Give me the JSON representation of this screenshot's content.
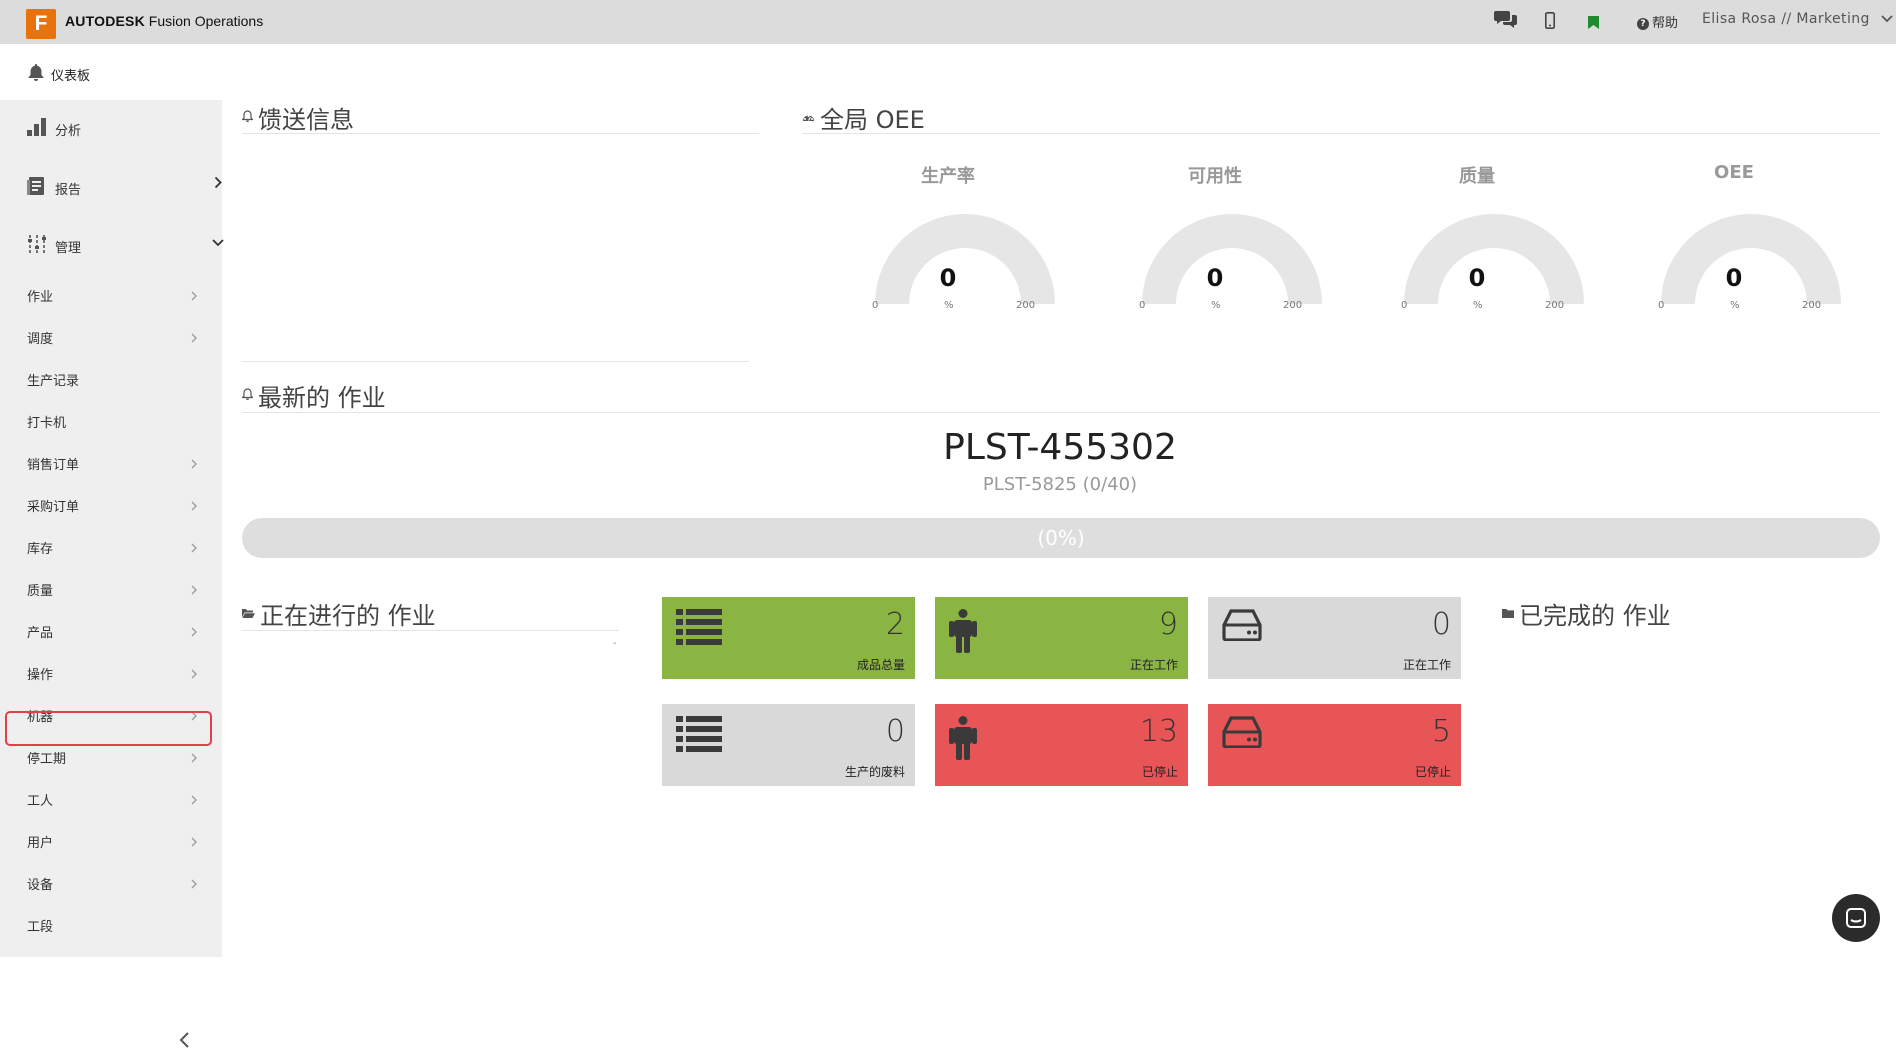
{
  "topbar": {
    "logo_letter": "F",
    "brand_bold": "AUTODESK",
    "brand_rest": " Fusion Operations",
    "help_label": "帮助",
    "user_label": "Elisa Rosa // Marketing",
    "icons": [
      "chat-icon",
      "mobile-icon",
      "bookmark-icon",
      "help-icon",
      "chevron-down-icon"
    ]
  },
  "subheader": {
    "dashboard_label": "仪表板"
  },
  "sidebar": {
    "main": [
      {
        "label": "分析",
        "icon": "bar-chart-icon"
      },
      {
        "label": "报告",
        "icon": "report-icon"
      },
      {
        "label": "管理",
        "icon": "sliders-icon"
      }
    ],
    "items": [
      {
        "label": "作业",
        "chevron": "›"
      },
      {
        "label": "调度",
        "chevron": "›"
      },
      {
        "label": "生产记录",
        "chevron": ""
      },
      {
        "label": "打卡机",
        "chevron": ""
      },
      {
        "label": "销售订单",
        "chevron": "›"
      },
      {
        "label": "采购订单",
        "chevron": "›"
      },
      {
        "label": "库存",
        "chevron": "›"
      },
      {
        "label": "质量",
        "chevron": "›"
      },
      {
        "label": "产品",
        "chevron": "›"
      },
      {
        "label": "操作",
        "chevron": "›"
      },
      {
        "label": "机器",
        "chevron": "›"
      },
      {
        "label": "停工期",
        "chevron": "›"
      },
      {
        "label": "工人",
        "chevron": "›"
      },
      {
        "label": "用户",
        "chevron": "›"
      },
      {
        "label": "设备",
        "chevron": "›"
      },
      {
        "label": "工段",
        "chevron": ""
      }
    ],
    "chevron_right": "›",
    "chevron_down": "⌄",
    "collapse": "‹"
  },
  "feed": {
    "title": "馈送信息"
  },
  "oee": {
    "title": "全局 OEE",
    "gauges": [
      {
        "title": "生产率",
        "value": "0",
        "unit": "%",
        "min": "0",
        "max": "200"
      },
      {
        "title": "可用性",
        "value": "0",
        "unit": "%",
        "min": "0",
        "max": "200"
      },
      {
        "title": "质量",
        "value": "0",
        "unit": "%",
        "min": "0",
        "max": "200"
      },
      {
        "title": "OEE",
        "value": "0",
        "unit": "%",
        "min": "0",
        "max": "200"
      }
    ]
  },
  "latest": {
    "title": "最新的 作业",
    "job_id": "PLST-455302",
    "sub": "PLST-5825 (0/40)",
    "progress_label": "(0%)",
    "progress_fraction": 0
  },
  "in_progress": {
    "title": "正在进行的 作业",
    "dash": "-"
  },
  "completed": {
    "title": "已完成的 作业"
  },
  "tiles": [
    {
      "value": "2",
      "label": "成品总量",
      "icon": "list-icon",
      "color": "#8ab542"
    },
    {
      "value": "9",
      "label": "正在工作",
      "icon": "worker-icon",
      "color": "#8ab542"
    },
    {
      "value": "0",
      "label": "正在工作",
      "icon": "machine-icon",
      "color": "#d9d9d9"
    },
    {
      "value": "0",
      "label": "生产的废料",
      "icon": "list-icon",
      "color": "#d9d9d9"
    },
    {
      "value": "13",
      "label": "已停止",
      "icon": "worker-icon",
      "color": "#e85557"
    },
    {
      "value": "5",
      "label": "已停止",
      "icon": "machine-icon",
      "color": "#e85557"
    }
  ]
}
